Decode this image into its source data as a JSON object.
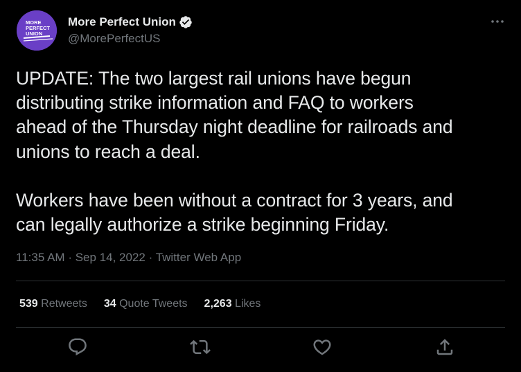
{
  "author": {
    "display_name": "More Perfect Union",
    "handle": "@MorePerfectUS",
    "avatar_text_line1": "MORE",
    "avatar_text_line2": "PERFECT",
    "avatar_text_line3": "UNION",
    "avatar_color": "#6a3fc6",
    "verified_icon": "verified-badge-icon"
  },
  "tweet": {
    "text": "UPDATE: The two largest rail unions have begun\ndistributing strike information and FAQ to workers\nahead of the Thursday night deadline for railroads and\nunions to reach a deal.\n\nWorkers have been without a contract for 3 years, and\ncan legally authorize a strike beginning Friday.",
    "time": "11:35 AM",
    "date": "Sep 14, 2022",
    "source": "Twitter Web App",
    "separator": "·"
  },
  "stats": {
    "retweets_count": "539",
    "retweets_label": "Retweets",
    "quote_count": "34",
    "quote_label": "Quote Tweets",
    "likes_count": "2,263",
    "likes_label": "Likes"
  },
  "actions": {
    "reply_icon": "reply-icon",
    "retweet_icon": "retweet-icon",
    "like_icon": "heart-icon",
    "share_icon": "share-icon",
    "more_icon": "more-options-icon"
  },
  "colors": {
    "background": "#000000",
    "text_primary": "#e7e9ea",
    "text_secondary": "#71767b",
    "divider": "#2f3336",
    "verified": "#e7e9ea"
  }
}
